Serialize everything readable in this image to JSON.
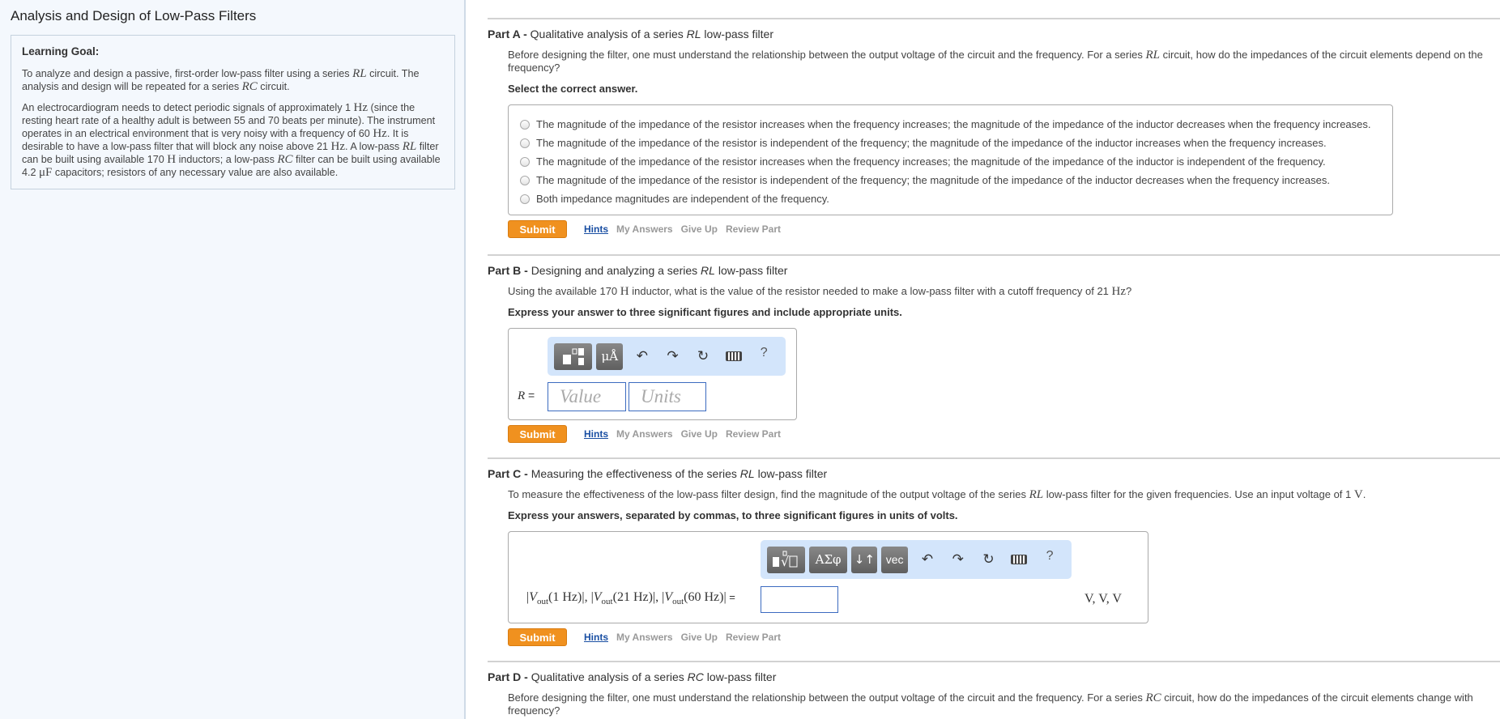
{
  "page_title": "Analysis and Design of Low-Pass Filters",
  "learning_goal": {
    "heading": "Learning Goal:",
    "para1": {
      "t1": "To analyze and design a passive, first-order low-pass filter using a series ",
      "m1": "RL",
      "t2": " circuit. The analysis and design will be repeated for a series ",
      "m2": "RC",
      "t3": " circuit."
    },
    "para2": {
      "t1": "An electrocardiogram needs to detect periodic signals of approximately 1 ",
      "u1": "Hz",
      "t2": " (since the resting heart rate of a healthy adult is between 55 and 70 beats per minute). The instrument operates in an electrical environment that is very noisy with a frequency of 60 ",
      "u2": "Hz",
      "t3": ". It is desirable to have a low-pass filter that will block any noise above 21 ",
      "u3": "Hz",
      "t4": ". A low-pass ",
      "m1": "RL",
      "t5": " filter can be built using available 170 ",
      "u4": "H",
      "t6": " inductors; a low-pass ",
      "m2": "RC",
      "t7": " filter can be built using available 4.2 ",
      "u5": "μF",
      "t8": " capacitors; resistors of any necessary value are also available."
    }
  },
  "actions": {
    "submit": "Submit",
    "hints": "Hints",
    "my_answers": "My Answers",
    "give_up": "Give Up",
    "review_part": "Review Part"
  },
  "part_a": {
    "label": "Part A - ",
    "title_pre": "Qualitative analysis of a series ",
    "title_em": "RL",
    "title_post": " low-pass filter",
    "q_pre": "Before designing the filter, one must understand the relationship between the output voltage of the circuit and the frequency. For a series ",
    "q_m": "RL",
    "q_post": " circuit, how do the impedances of the circuit elements depend on the frequency?",
    "instruction": "Select the correct answer.",
    "choices": [
      "The magnitude of the impedance of the resistor increases when the frequency increases; the magnitude of the impedance of the inductor decreases when the frequency increases.",
      "The magnitude of the impedance of the resistor is independent of the frequency; the magnitude of the impedance of the inductor increases when the frequency increases.",
      "The magnitude of the impedance of the resistor increases when the frequency increases; the magnitude of the impedance of the inductor is independent of the frequency.",
      "The magnitude of the impedance of the resistor is independent of the frequency; the magnitude of the impedance of the inductor decreases when the frequency increases.",
      "Both impedance magnitudes are independent of the frequency."
    ]
  },
  "part_b": {
    "label": "Part B - ",
    "title_pre": "Designing and analyzing a series ",
    "title_em": "RL",
    "title_post": " low-pass filter",
    "q_pre": "Using the available 170 ",
    "q_u1": "H",
    "q_mid": " inductor, what is the value of the resistor needed to make a low-pass filter with a cutoff frequency of 21 ",
    "q_u2": "Hz",
    "q_post": "?",
    "instruction": "Express your answer to three significant figures and include appropriate units.",
    "toolbar": {
      "templates": "▆▫▯",
      "units": "μÅ",
      "undo": "↶",
      "redo": "↷",
      "reset": "↻",
      "keyboard": "",
      "help": "?"
    },
    "var_label": "R",
    "equals": " =",
    "value_placeholder": "Value",
    "units_placeholder": "Units",
    "value": "",
    "units": ""
  },
  "part_c": {
    "label": "Part C - ",
    "title_pre": "Measuring the effectiveness of the series ",
    "title_em": "RL",
    "title_post": " low-pass filter",
    "q_pre": "To measure the effectiveness of the low-pass filter design, find the magnitude of the output voltage of the series ",
    "q_m": "RL",
    "q_mid": " low-pass filter for the given frequencies. Use an input voltage of 1 ",
    "q_u": "V",
    "q_post": ".",
    "instruction": "Express your answers, separated by commas, to three significant figures in units of volts.",
    "toolbar": {
      "templates": "√□",
      "greek": "ΑΣφ",
      "arrows": "↓↑",
      "vec": "vec",
      "undo": "↶",
      "redo": "↷",
      "reset": "↻",
      "help": "?"
    },
    "expr": "|Vout(1 Hz)|, |Vout(21 Hz)|, |Vout(60 Hz)|",
    "expr_parts": [
      "|",
      "V",
      "out",
      "(1 Hz)|, |",
      "V",
      "out",
      "(21 Hz)|, |",
      "V",
      "out",
      "(60 Hz)|"
    ],
    "equals": " =",
    "value": "",
    "units_suffix": "V, V, V"
  },
  "part_d": {
    "label": "Part D - ",
    "title_pre": "Qualitative analysis of a series ",
    "title_em": "RC",
    "title_post": " low-pass filter",
    "q_pre": "Before designing the filter, one must understand the relationship between the output voltage of the circuit and the frequency. For a series ",
    "q_m": "RC",
    "q_post": " circuit, how do the impedances of the circuit elements change with frequency?"
  }
}
